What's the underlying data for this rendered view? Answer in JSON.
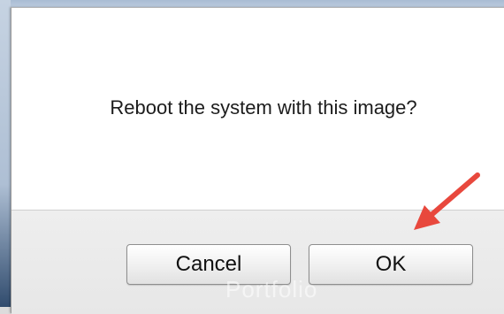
{
  "dialog": {
    "message": "Reboot the system with this image?",
    "cancel_label": "Cancel",
    "ok_label": "OK"
  },
  "background": {
    "watermark_text": "Portfolio"
  },
  "annotation": {
    "icon": "red-arrow-icon",
    "color": "#e8483d"
  }
}
